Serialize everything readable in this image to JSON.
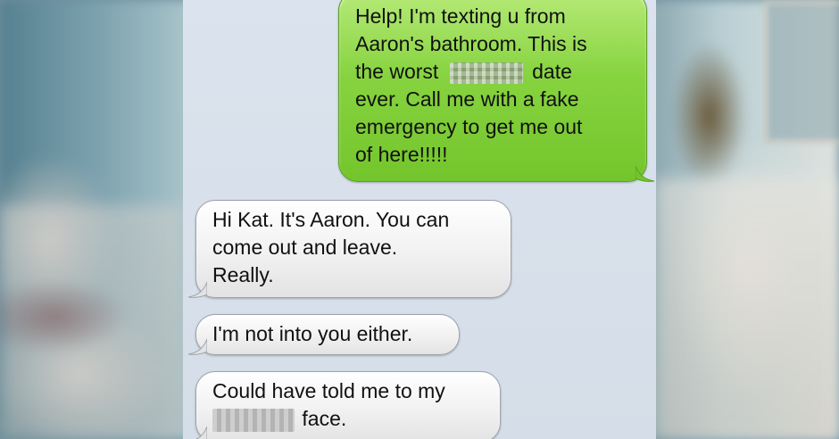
{
  "thread": {
    "messages": [
      {
        "direction": "sent",
        "lines": [
          "Help! I'm texting u from",
          "Aaron's bathroom. This is",
          "the worst",
          "date",
          "ever. Call me with a fake",
          "emergency to get me out",
          "of here!!!!!"
        ]
      },
      {
        "direction": "received",
        "lines": [
          "Hi Kat. It's Aaron. You can",
          "come out and leave.",
          "Really."
        ]
      },
      {
        "direction": "received",
        "lines": [
          "I'm not into you either."
        ]
      },
      {
        "direction": "received",
        "lines": [
          "Could have told me to my",
          "face."
        ]
      }
    ]
  },
  "colors": {
    "sent_bubble": "#86d33f",
    "received_bubble": "#f1f1f1",
    "thread_background": "#d9e1eb"
  }
}
